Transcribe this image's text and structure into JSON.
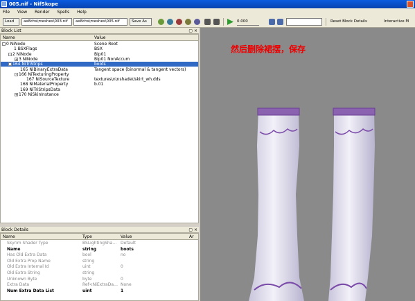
{
  "window": {
    "title": "005.nif - NifSkope"
  },
  "menu": [
    "File",
    "View",
    "Render",
    "Spells",
    "Help"
  ],
  "toolbar": {
    "load_label": "Load",
    "load_path": "ax8chs\\meshes\\003.nif",
    "save_path": "ax8chs\\meshes\\005.nif",
    "save_as_label": "Save As",
    "time_value": "0.000",
    "reset_label": "Reset Block Details",
    "interactive_label": "Interactive M"
  },
  "block_list": {
    "title": "Block List",
    "col_name": "Name",
    "col_value": "Value",
    "rows": [
      {
        "name": "0 NiNode",
        "value": "Scene Root",
        "indent": 0,
        "exp": "-"
      },
      {
        "name": "1 BSXFlags",
        "value": "BSX",
        "indent": 1,
        "exp": ""
      },
      {
        "name": "2 NiNode",
        "value": "Bip01",
        "indent": 1,
        "exp": "-"
      },
      {
        "name": "3 NiNode",
        "value": "Bip01 NonAccum",
        "indent": 2,
        "exp": "+"
      },
      {
        "name": "164 NiTriStrips",
        "value": "boots",
        "indent": 1,
        "exp": "-",
        "sel": true
      },
      {
        "name": "165 NiBinaryExtraData",
        "value": "Tangent space (binormal & tangent vectors)",
        "indent": 2,
        "exp": ""
      },
      {
        "name": "166 NiTexturingProperty",
        "value": "",
        "indent": 2,
        "exp": "-"
      },
      {
        "name": "167 NiSourceTexture",
        "value": "textures\\n\\nshade\\lskirt_wh.dds",
        "indent": 3,
        "exp": ""
      },
      {
        "name": "168 NiMaterialProperty",
        "value": "b.01",
        "indent": 2,
        "exp": ""
      },
      {
        "name": "169 NiTriStripsData",
        "value": "",
        "indent": 2,
        "exp": ""
      },
      {
        "name": "170 NiSkinInstance",
        "value": "",
        "indent": 2,
        "exp": "+"
      }
    ]
  },
  "block_details": {
    "title": "Block Details",
    "cols": [
      "Name",
      "Type",
      "Value",
      "Ar"
    ],
    "rows": [
      {
        "name": "Skyrim Shader Type",
        "type": "BSLightingSha…",
        "value": "Default",
        "bold": false
      },
      {
        "name": "Name",
        "type": "string",
        "value": "boots",
        "bold": true
      },
      {
        "name": "Has Old Extra Data",
        "type": "bool",
        "value": "no",
        "bold": false
      },
      {
        "name": "Old Extra Prop Name",
        "type": "string",
        "value": "",
        "bold": false
      },
      {
        "name": "Old Extra Internal Id",
        "type": "uint",
        "value": "0",
        "bold": false
      },
      {
        "name": "Old Extra String",
        "type": "string",
        "value": "",
        "bold": false
      },
      {
        "name": "Unknown Byte",
        "type": "byte",
        "value": "0",
        "bold": false
      },
      {
        "name": "Extra Data",
        "type": "Ref<NiExtraDa…",
        "value": "None",
        "bold": false
      },
      {
        "name": "Num Extra Data List",
        "type": "uint",
        "value": "1",
        "bold": true
      }
    ]
  },
  "viewport": {
    "overlay_text": "然后删除裙摆，保存"
  }
}
